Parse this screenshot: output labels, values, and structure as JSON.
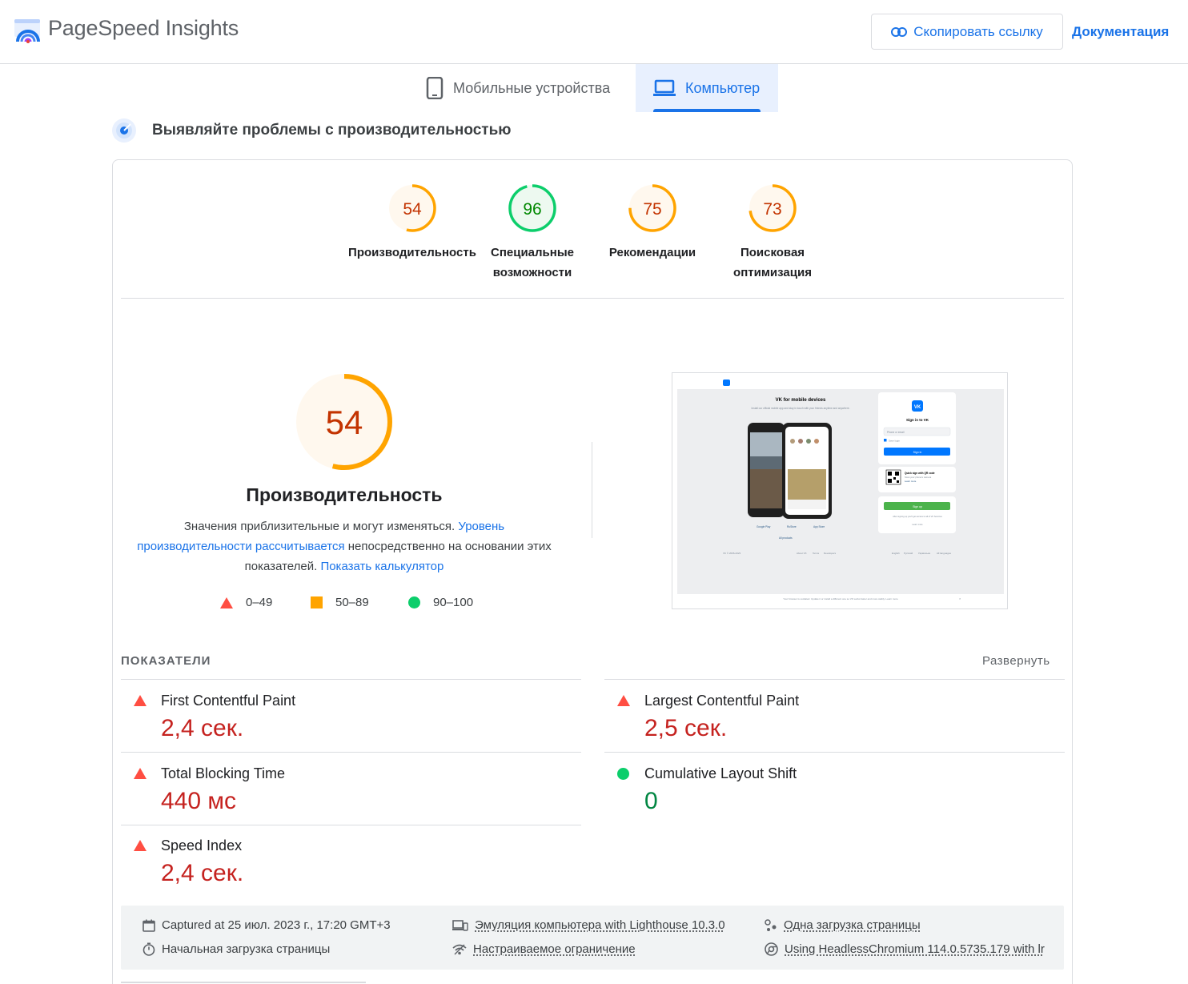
{
  "header": {
    "app_title": "PageSpeed Insights",
    "copy_link_label": "Скопировать ссылку",
    "docs_label": "Документация"
  },
  "tabs": [
    {
      "label": "Мобильные устройства",
      "icon": "smartphone-icon",
      "active": false
    },
    {
      "label": "Компьютер",
      "icon": "laptop-icon",
      "active": true
    }
  ],
  "section": {
    "title": "Выявляйте проблемы с производительностью"
  },
  "categories": [
    {
      "score": "54",
      "label_lines": [
        "Производительность"
      ],
      "status": "average"
    },
    {
      "score": "96",
      "label_lines": [
        "Специальные",
        "возможности"
      ],
      "status": "pass"
    },
    {
      "score": "75",
      "label_lines": [
        "Рекомендации"
      ],
      "status": "average"
    },
    {
      "score": "73",
      "label_lines": [
        "Поисковая",
        "оптимизация"
      ],
      "status": "average"
    }
  ],
  "performance": {
    "score": "54",
    "title": "Производительность",
    "desc_1": "Значения приблизительные и могут изменяться. ",
    "desc_link_1": "Уровень производительности рассчитывается",
    "desc_2": " непосредственно на основании этих показателей. ",
    "desc_link_2": "Показать калькулятор",
    "legend": [
      {
        "range": "0–49",
        "shape": "triangle",
        "color": "#ff4e42"
      },
      {
        "range": "50–89",
        "shape": "square",
        "color": "#ffa400"
      },
      {
        "range": "90–100",
        "shape": "circle",
        "color": "#0cce6b"
      }
    ]
  },
  "thumbnail": {
    "site_heading": "VK for mobile devices",
    "site_subtext": "Install our official mobile app and stay in touch with your friends anytime and anywhere.",
    "signin_title": "Sign in to VK",
    "email_placeholder": "Phone or email",
    "save_login": "Save login",
    "signin_button": "Sign in",
    "qr_title": "Quick sign with QR code",
    "qr_sub": "Scan your phone's camera",
    "qr_link": "Learn more",
    "signup_button": "Sign up",
    "signup_note": "After signing up you'll get access to all of VK Services",
    "learn_more": "Learn more",
    "stores": [
      "Google Play",
      "RuStore",
      "App Store"
    ],
    "all_products": "All products",
    "footer_left": "VK © 2006-2023",
    "footer_links": [
      "About VK",
      "Terms",
      "Developers"
    ],
    "footer_langs": [
      "English",
      "Русский",
      "Українська",
      "All languages"
    ],
    "banner": "Your browser is outdated. Update it or install a different one so VK works faster and more stably. Learn more",
    "banner_close": "×"
  },
  "metrics": {
    "heading": "ПОКАЗАТЕЛИ",
    "expand_label": "Развернуть",
    "items": [
      {
        "name": "First Contentful Paint",
        "value": "2,4 сек.",
        "status": "fail",
        "color": "#c5221f"
      },
      {
        "name": "Largest Contentful Paint",
        "value": "2,5 сек.",
        "status": "fail",
        "color": "#c5221f"
      },
      {
        "name": "Total Blocking Time",
        "value": "440 мс",
        "status": "fail",
        "color": "#c5221f"
      },
      {
        "name": "Cumulative Layout Shift",
        "value": "0",
        "status": "pass",
        "color": "#018642"
      },
      {
        "name": "Speed Index",
        "value": "2,4 сек.",
        "status": "fail",
        "color": "#c5221f"
      }
    ]
  },
  "run_info": {
    "captured": "Captured at 25 июл. 2023 г., 17:20 GMT+3",
    "initial_load": "Начальная загрузка страницы",
    "emulation": "Эмуляция компьютера with Lighthouse 10.3.0",
    "throttling": "Настраиваемое ограничение",
    "single_load": "Одна загрузка страницы",
    "browser": "Using HeadlessChromium 114.0.5735.179 with lr"
  },
  "colors": {
    "accent": "#1a73e8",
    "fail": "#ff4e42",
    "average": "#ffa400",
    "pass": "#0cce6b",
    "fail_text": "#c5221f",
    "average_text": "#c33300",
    "pass_text": "#008800"
  }
}
